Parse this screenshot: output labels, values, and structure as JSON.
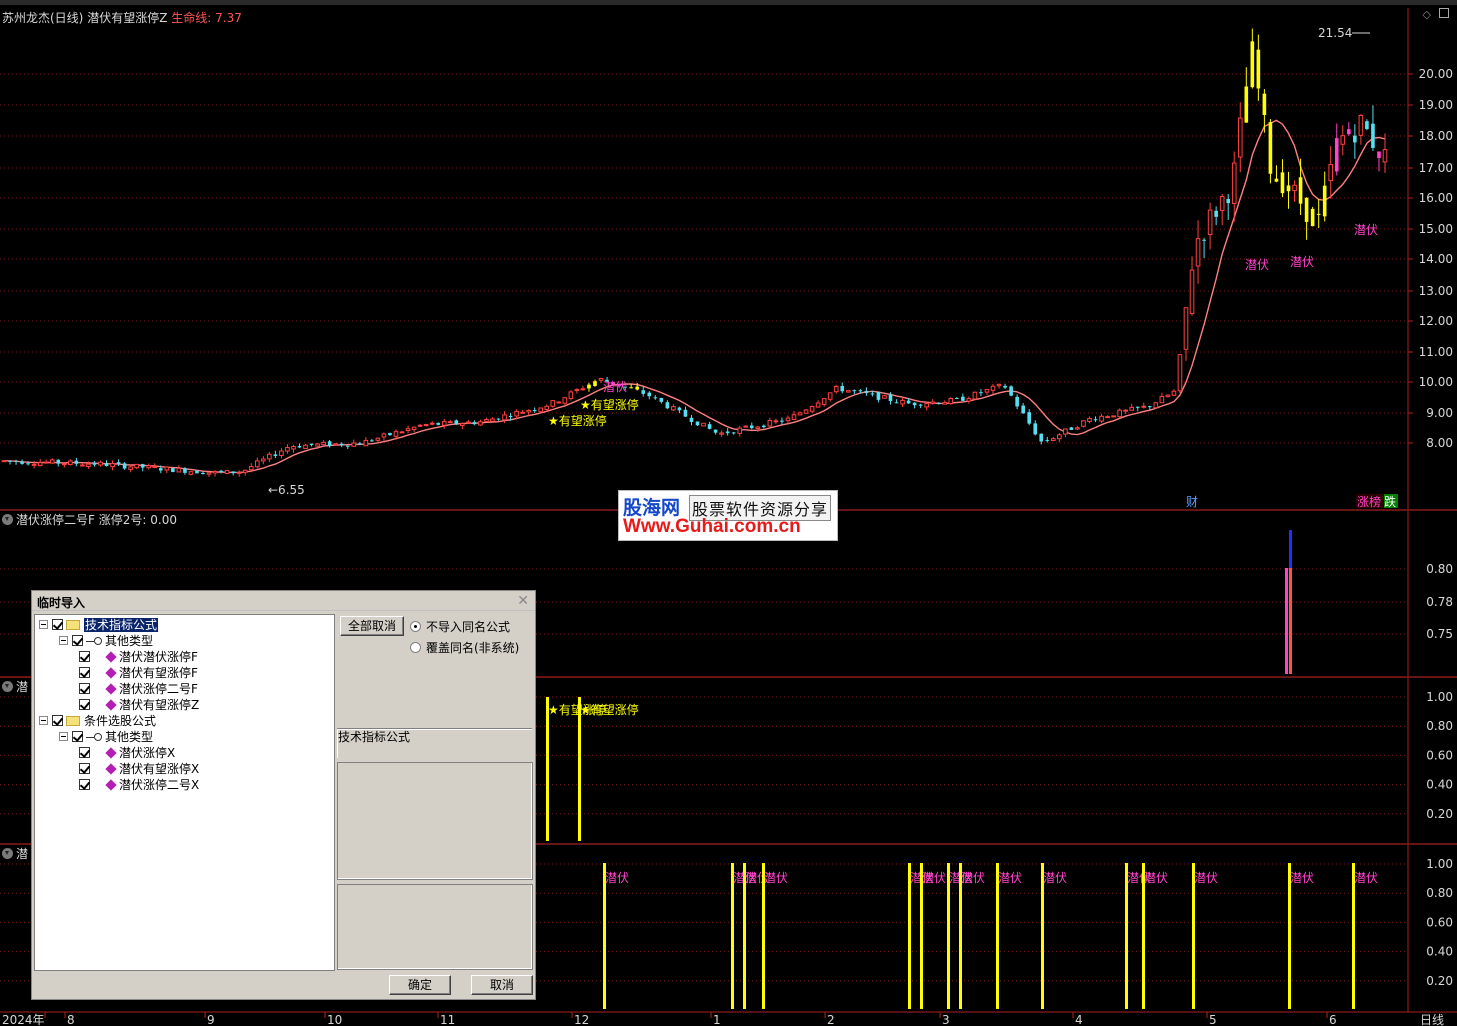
{
  "header": {
    "stock_name": "苏州龙杰(日线)",
    "indicator_name": "潜伏有望涨停Z",
    "lifeline_label": "生命线:",
    "lifeline_value": "7.37"
  },
  "pane2": {
    "indicator_name": "潜伏涨停二号F",
    "value_label": "涨停2号:",
    "value": "0.00"
  },
  "pane3": {
    "indicator_name": "潜"
  },
  "pane4": {
    "indicator_name": "潜"
  },
  "price_axis": {
    "labels": [
      "20.00",
      "19.00",
      "18.00",
      "17.00",
      "16.00",
      "15.00",
      "14.00",
      "13.00",
      "12.00",
      "11.00",
      "10.00",
      "9.00",
      "8.00"
    ],
    "values": [
      20,
      19,
      18,
      17,
      16,
      15,
      14,
      13,
      12,
      11,
      10,
      9,
      8
    ]
  },
  "pane2_axis": {
    "labels": [
      "0.80",
      "0.78",
      "0.75"
    ],
    "values": [
      0.8,
      0.78,
      0.75
    ]
  },
  "pane3_axis": {
    "labels": [
      "1.00",
      "0.80",
      "0.60",
      "0.40",
      "0.20"
    ],
    "values": [
      1.0,
      0.8,
      0.6,
      0.4,
      0.2
    ]
  },
  "pane4_axis": {
    "labels": [
      "1.00",
      "0.80",
      "0.60",
      "0.40",
      "0.20"
    ],
    "values": [
      1.0,
      0.8,
      0.6,
      0.4,
      0.2
    ]
  },
  "time_axis": {
    "labels": [
      "2024年",
      "8",
      "9",
      "10",
      "11",
      "12",
      "1",
      "2",
      "3",
      "4",
      "5",
      "6"
    ],
    "period": "日线"
  },
  "annotations": {
    "high_price": "21.54",
    "low_price": "6.55",
    "signal_hope": "★有望涨停",
    "signal_latent": "潜伏",
    "cai": "财",
    "zhangbang": "涨榜",
    "die": "跌"
  },
  "watermark": {
    "brand": "股海网",
    "slogan": "股票软件资源分享",
    "url": "Www.Guhai.com.cn"
  },
  "dialog": {
    "title": "临时导入",
    "tree": [
      {
        "label": "技术指标公式",
        "level": 0,
        "type": "folder",
        "selected": true
      },
      {
        "label": "其他类型",
        "level": 1,
        "type": "group"
      },
      {
        "label": "潜伏潜伏涨停F",
        "level": 2,
        "type": "item"
      },
      {
        "label": "潜伏有望涨停F",
        "level": 2,
        "type": "item"
      },
      {
        "label": "潜伏涨停二号F",
        "level": 2,
        "type": "item"
      },
      {
        "label": "潜伏有望涨停Z",
        "level": 2,
        "type": "item"
      },
      {
        "label": "条件选股公式",
        "level": 0,
        "type": "folder"
      },
      {
        "label": "其他类型",
        "level": 1,
        "type": "group"
      },
      {
        "label": "潜伏涨停X",
        "level": 2,
        "type": "item"
      },
      {
        "label": "潜伏有望涨停X",
        "level": 2,
        "type": "item"
      },
      {
        "label": "潜伏涨停二号X",
        "level": 2,
        "type": "item"
      }
    ],
    "cancel_all_label": "全部取消",
    "radio_no_import": "不导入同名公式",
    "radio_overwrite": "覆盖同名(非系统)",
    "section_label": "技术指标公式",
    "ok_label": "确定",
    "cancel_label": "取消"
  },
  "colors": {
    "up": "#ff4040",
    "down": "#54e0f0",
    "signal_yellow": "#ffff00",
    "magenta": "#ff44cc",
    "ma_line": "#ff8080",
    "grid": "#7a1a1a",
    "axis_label": "#d8d8d8"
  },
  "chart_data": {
    "type": "candlestick",
    "ma_label": "生命线",
    "ma_last": 7.37,
    "max_price": 21.54,
    "min_price": 6.55,
    "pane3_signal_count": 2,
    "pane4_signal_count": 16
  }
}
